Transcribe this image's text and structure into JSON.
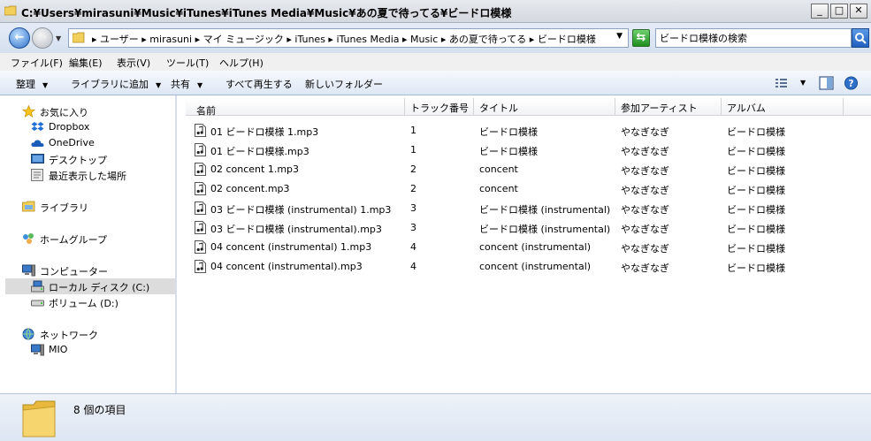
{
  "window": {
    "title": "C:¥Users¥mirasuni¥Music¥iTunes¥iTunes Media¥Music¥あの夏で待ってる¥ビードロ模様",
    "minimize": "_",
    "maximize": "□",
    "close": "✕"
  },
  "address": {
    "path": "▸ ユーザー ▸ mirasuni ▸ マイ ミュージック ▸ iTunes ▸ iTunes Media ▸ Music ▸ あの夏で待ってる ▸ ビードロ模様",
    "search_placeholder": "ビードロ模様の検索"
  },
  "menu": [
    "ファイル(F)",
    "編集(E)",
    "表示(V)",
    "ツール(T)",
    "ヘルプ(H)"
  ],
  "toolbar": {
    "organize": "整理",
    "add_to_library": "ライブラリに追加",
    "share": "共有",
    "play_all": "すべて再生する",
    "new_folder": "新しいフォルダー"
  },
  "sidebar": {
    "favorites": "お気に入り",
    "dropbox": "Dropbox",
    "onedrive": "OneDrive",
    "desktop": "デスクトップ",
    "recent": "最近表示した場所",
    "libraries": "ライブラリ",
    "homegroup": "ホームグループ",
    "computer": "コンピューター",
    "local_disk": "ローカル ディスク (C:)",
    "volume": "ボリューム (D:)",
    "network": "ネットワーク",
    "mio": "MIO"
  },
  "columns": {
    "name": "名前",
    "track": "トラック番号",
    "title": "タイトル",
    "artist": "参加アーティスト",
    "album": "アルバム"
  },
  "files": [
    {
      "name": "01 ビードロ模様 1.mp3",
      "track": "1",
      "title": "ビードロ模様",
      "artist": "やなぎなぎ",
      "album": "ビードロ模様"
    },
    {
      "name": "01 ビードロ模様.mp3",
      "track": "1",
      "title": "ビードロ模様",
      "artist": "やなぎなぎ",
      "album": "ビードロ模様"
    },
    {
      "name": "02 concent 1.mp3",
      "track": "2",
      "title": "concent",
      "artist": "やなぎなぎ",
      "album": "ビードロ模様"
    },
    {
      "name": "02 concent.mp3",
      "track": "2",
      "title": "concent",
      "artist": "やなぎなぎ",
      "album": "ビードロ模様"
    },
    {
      "name": "03 ビードロ模様 (instrumental) 1.mp3",
      "track": "3",
      "title": "ビードロ模様 (instrumental)",
      "artist": "やなぎなぎ",
      "album": "ビードロ模様"
    },
    {
      "name": "03 ビードロ模様 (instrumental).mp3",
      "track": "3",
      "title": "ビードロ模様 (instrumental)",
      "artist": "やなぎなぎ",
      "album": "ビードロ模様"
    },
    {
      "name": "04 concent (instrumental) 1.mp3",
      "track": "4",
      "title": "concent (instrumental)",
      "artist": "やなぎなぎ",
      "album": "ビードロ模様"
    },
    {
      "name": "04 concent (instrumental).mp3",
      "track": "4",
      "title": "concent (instrumental)",
      "artist": "やなぎなぎ",
      "album": "ビードロ模様"
    }
  ],
  "status": {
    "item_count": "8 個の項目"
  },
  "colors": {
    "accent": "#2e6fc8",
    "folder": "#f2cf5b",
    "selected": "#dcdcdc"
  }
}
